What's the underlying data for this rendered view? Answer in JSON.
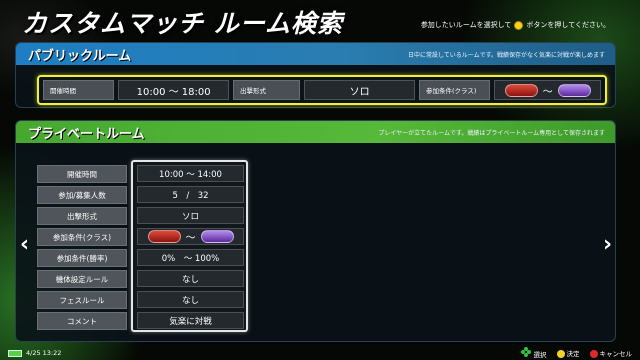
{
  "page_title": "カスタムマッチ ルーム検索",
  "hint": {
    "before": "参加したいルームを選択して",
    "after": "ボタンを押してください。"
  },
  "public": {
    "header": "パブリックルーム",
    "note": "日中に常設しているルームです。戦績保存がなく気楽に対戦が楽しめます",
    "time_label": "開催時間",
    "time_value": "10:00 ～ 18:00",
    "mode_label": "出撃形式",
    "mode_value": "ソロ",
    "class_label": "参加条件(クラス)",
    "tilde": "～"
  },
  "private": {
    "header": "プライベートルーム",
    "note": "プレイヤーが立てたルームです。戦績はプライベートルーム専用として保存されます",
    "rows": [
      {
        "label": "開催時間",
        "value": "10:00 ～ 14:00"
      },
      {
        "label": "参加/募集人数",
        "value": "5　/　32"
      },
      {
        "label": "出撃形式",
        "value": "ソロ"
      },
      {
        "label": "参加条件(クラス)",
        "value": ""
      },
      {
        "label": "参加条件(勝率)",
        "value": "0%　～ 100%"
      },
      {
        "label": "機体設定ルール",
        "value": "なし"
      },
      {
        "label": "フェスルール",
        "value": "なし"
      },
      {
        "label": "コメント",
        "value": "気楽に対戦"
      }
    ],
    "tilde": "～"
  },
  "nav": {
    "left_arrow": "‹",
    "right_arrow": "›"
  },
  "footer": {
    "datetime": "4/25 13:22",
    "select": "選択",
    "confirm": "決定",
    "cancel": "キャンセル"
  },
  "colors": {
    "public_header": "#1d7ec4",
    "private_header": "#46a82f",
    "highlight": "#f0f03a",
    "confirm_button": "#f7d21e",
    "cancel_button": "#e02a2a",
    "select_pad": "#2fc43a"
  },
  "icons": [
    "yellow-button-icon",
    "class-badge-red-icon",
    "class-badge-purple-icon",
    "battery-icon",
    "dpad-icon",
    "yellow-button-icon",
    "red-button-icon"
  ]
}
